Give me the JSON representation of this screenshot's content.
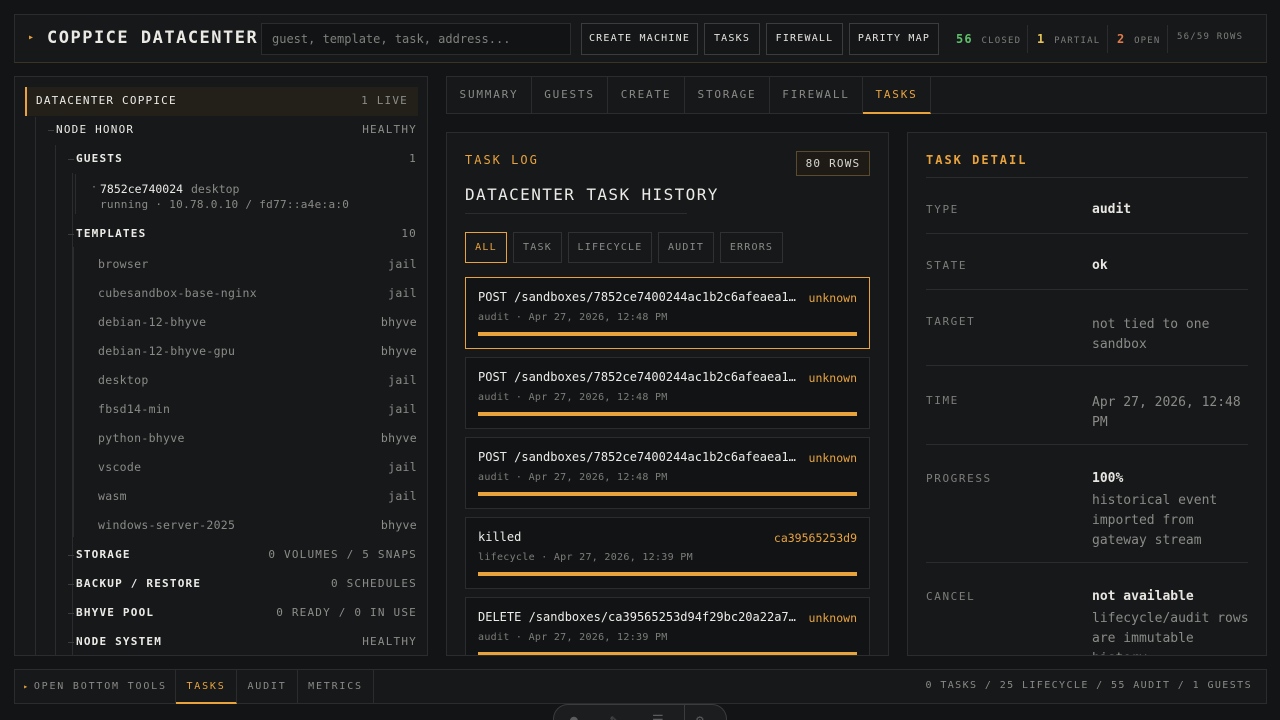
{
  "header": {
    "title": "COPPICE DATACENTER",
    "search_placeholder": "guest, template, task, address...",
    "buttons": {
      "create_machine": "CREATE MACHINE",
      "tasks": "TASKS",
      "firewall": "FIREWALL",
      "parity_map": "PARITY MAP"
    },
    "stats": {
      "closed_count": "56",
      "closed_label": "CLOSED",
      "partial_count": "1",
      "partial_label": "PARTIAL",
      "open_count": "2",
      "open_label": "OPEN",
      "rows": "56/59 ROWS"
    }
  },
  "tree": {
    "datacenter": {
      "label": "DATACENTER COPPICE",
      "value": "1 LIVE"
    },
    "node": {
      "label": "NODE HONOR",
      "value": "HEALTHY"
    },
    "guests": {
      "label": "GUESTS",
      "value": "1"
    },
    "guest": {
      "id": "7852ce740024",
      "template": "desktop",
      "detail": "running · 10.78.0.10 / fd77::a4e:a:0"
    },
    "templates": {
      "label": "TEMPLATES",
      "value": "10",
      "items": [
        {
          "name": "browser",
          "type": "jail"
        },
        {
          "name": "cubesandbox-base-nginx",
          "type": "jail"
        },
        {
          "name": "debian-12-bhyve",
          "type": "bhyve"
        },
        {
          "name": "debian-12-bhyve-gpu",
          "type": "bhyve"
        },
        {
          "name": "desktop",
          "type": "jail"
        },
        {
          "name": "fbsd14-min",
          "type": "jail"
        },
        {
          "name": "python-bhyve",
          "type": "bhyve"
        },
        {
          "name": "vscode",
          "type": "jail"
        },
        {
          "name": "wasm",
          "type": "jail"
        },
        {
          "name": "windows-server-2025",
          "type": "bhyve"
        }
      ]
    },
    "storage": {
      "label": "STORAGE",
      "value": "0 VOLUMES / 5 SNAPS"
    },
    "backup": {
      "label": "BACKUP / RESTORE",
      "value": "0 SCHEDULES"
    },
    "bhyve_pool": {
      "label": "BHYVE POOL",
      "value": "0 READY / 0 IN USE"
    },
    "node_system": {
      "label": "NODE SYSTEM",
      "value": "HEALTHY"
    }
  },
  "tabs": {
    "summary": "SUMMARY",
    "guests": "GUESTS",
    "create": "CREATE",
    "storage": "STORAGE",
    "firewall": "FIREWALL",
    "tasks": "TASKS"
  },
  "tasklog": {
    "kicker": "TASK LOG",
    "rows_badge": "80 ROWS",
    "title": "DATACENTER TASK HISTORY",
    "filters": {
      "all": "ALL",
      "task": "TASK",
      "lifecycle": "LIFECYCLE",
      "audit": "AUDIT",
      "errors": "ERRORS"
    },
    "items": [
      {
        "title": "POST /sandboxes/7852ce7400244ac1b2c6afeaea1c…",
        "status": "unknown",
        "meta": "audit · Apr 27, 2026, 12:48 PM",
        "progress": 1.0
      },
      {
        "title": "POST /sandboxes/7852ce7400244ac1b2c6afeaea1c…",
        "status": "unknown",
        "meta": "audit · Apr 27, 2026, 12:48 PM",
        "progress": 1.0
      },
      {
        "title": "POST /sandboxes/7852ce7400244ac1b2c6afeaea1c…",
        "status": "unknown",
        "meta": "audit · Apr 27, 2026, 12:48 PM",
        "progress": 1.0
      },
      {
        "title": "killed",
        "status": "ca39565253d9",
        "meta": "lifecycle · Apr 27, 2026, 12:39 PM",
        "progress": 1.0
      },
      {
        "title": "DELETE /sandboxes/ca39565253d94f29bc20a22a76…",
        "status": "unknown",
        "meta": "audit · Apr 27, 2026, 12:39 PM",
        "progress": 1.0
      }
    ]
  },
  "detail": {
    "kicker": "TASK DETAIL",
    "type_label": "TYPE",
    "type_value": "audit",
    "state_label": "STATE",
    "state_value": "ok",
    "target_label": "TARGET",
    "target_value": "not tied to one sandbox",
    "time_label": "TIME",
    "time_value": "Apr 27, 2026, 12:48 PM",
    "progress_label": "PROGRESS",
    "progress_value": "100%",
    "progress_note": "historical event imported from gateway stream",
    "cancel_label": "CANCEL",
    "cancel_value": "not available",
    "cancel_note": "lifecycle/audit rows are immutable history"
  },
  "bottom": {
    "open_tools": "OPEN BOTTOM TOOLS",
    "tabs": {
      "tasks": "TASKS",
      "audit": "AUDIT",
      "metrics": "METRICS"
    },
    "summary": "0 TASKS / 25 LIFECYCLE / 55 AUDIT / 1 GUESTS"
  },
  "colors": {
    "accent": "#e8a33d",
    "closed": "#5fbf6a",
    "partial": "#e6c45a",
    "open": "#e07a4a",
    "bg": "#121416"
  }
}
